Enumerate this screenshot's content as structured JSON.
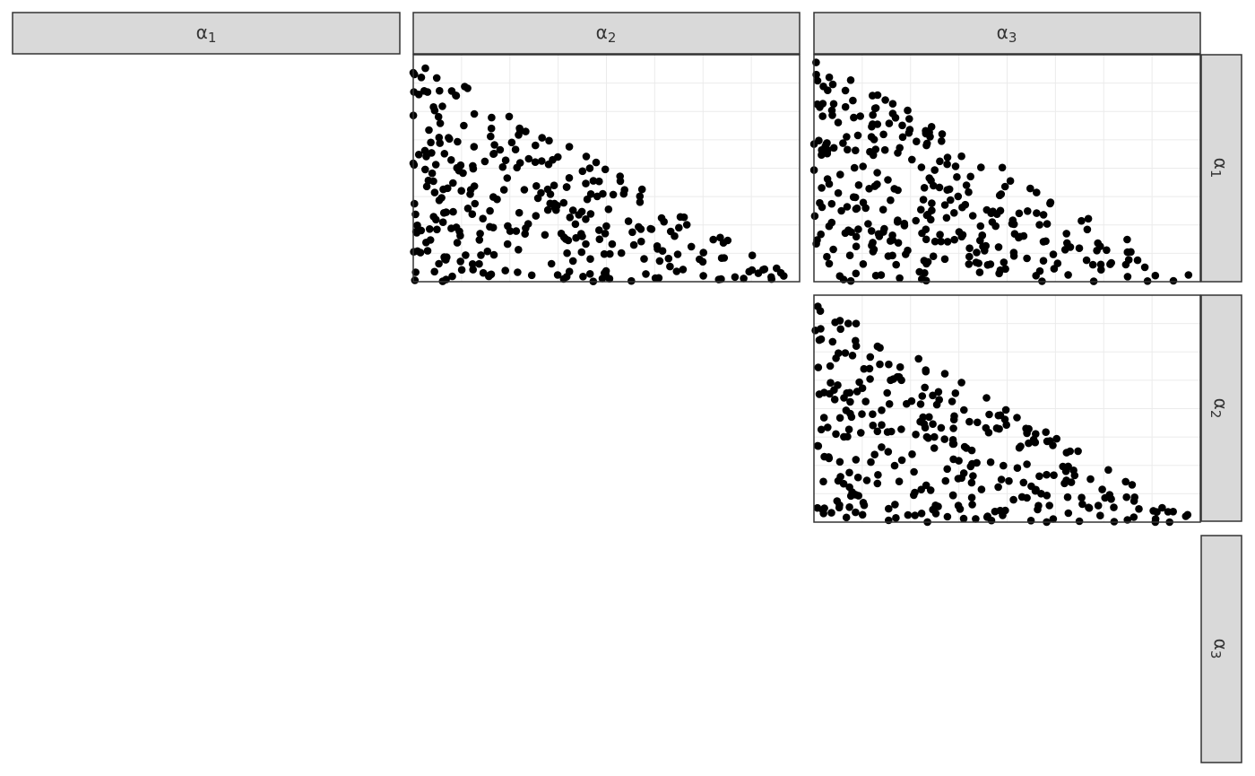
{
  "chart_data": {
    "type": "scatter",
    "layout": "facet-grid-upper-triangle",
    "col_strips": [
      "α1",
      "α2",
      "α3"
    ],
    "row_strips": [
      "α1",
      "α2",
      "α3"
    ],
    "grid": true,
    "panel_xlim": [
      0,
      1
    ],
    "panel_ylim": [
      0,
      1
    ],
    "seed": 7,
    "panels": [
      {
        "row": 0,
        "col": 1,
        "n_points": 300,
        "constraint": "x + y <= 1"
      },
      {
        "row": 0,
        "col": 2,
        "n_points": 300,
        "constraint": "x + y <= 1"
      },
      {
        "row": 1,
        "col": 2,
        "n_points": 300,
        "constraint": "x + y <= 1"
      }
    ],
    "point_color": "#000000",
    "strip_fill": "#d9d9d9",
    "strip_border": "#333333",
    "gridline_color": "#ebebeb"
  }
}
